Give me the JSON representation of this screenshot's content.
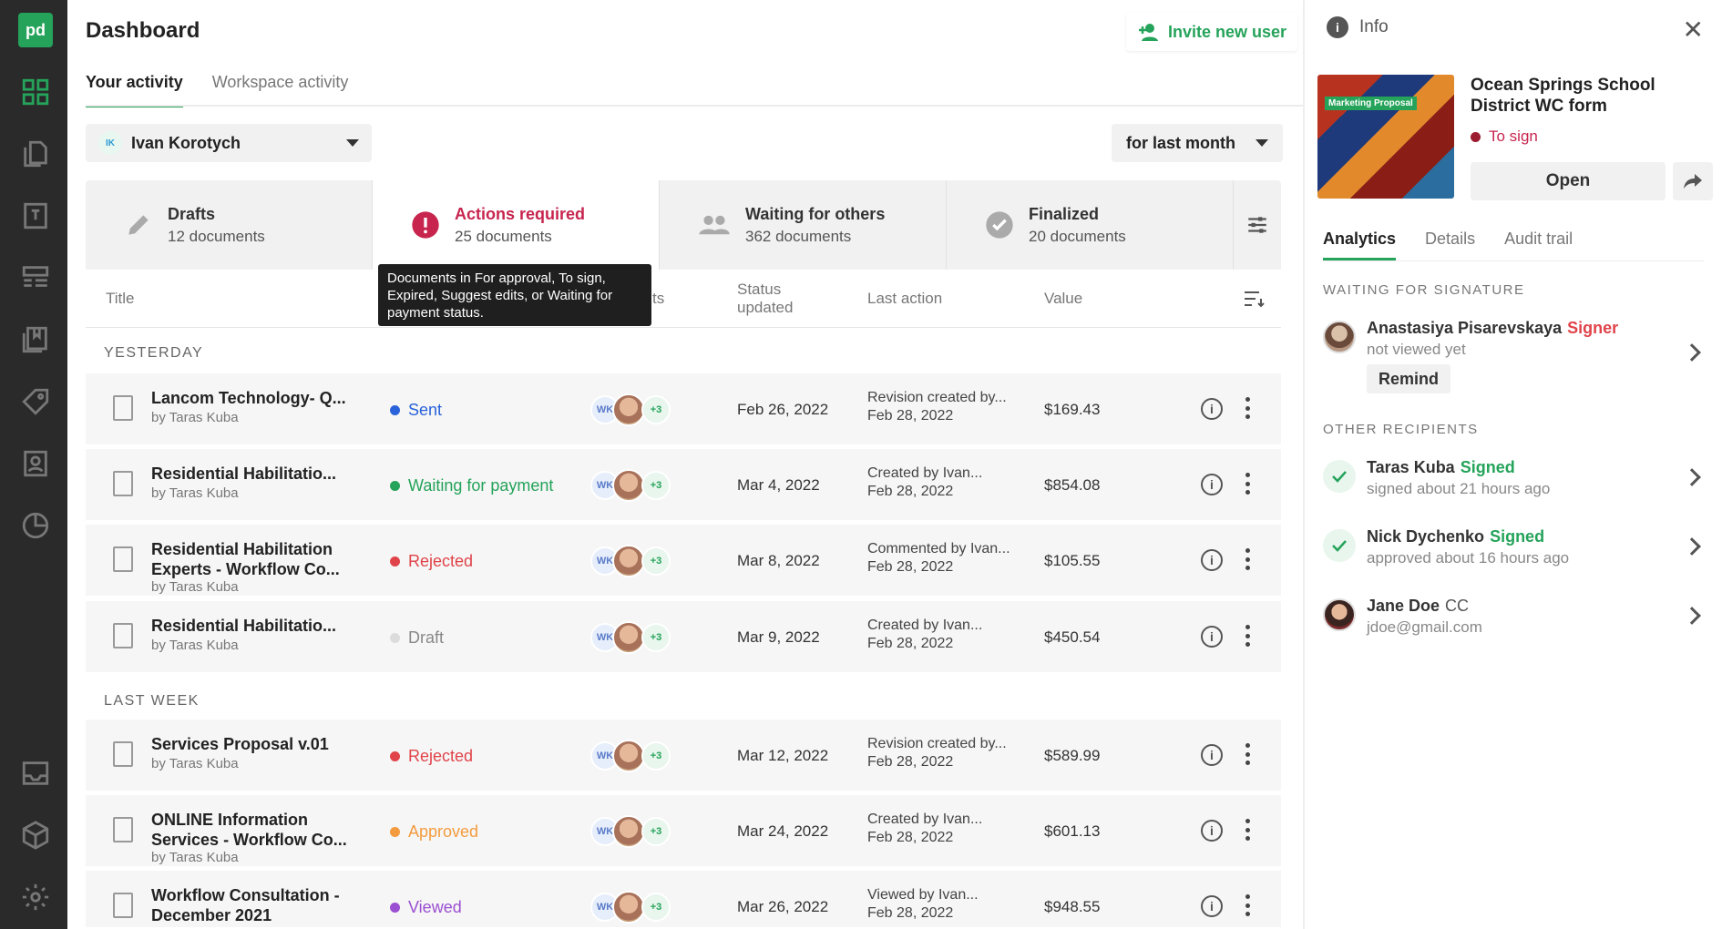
{
  "rail": {
    "logo": "pd",
    "icons": [
      "dashboard-icon",
      "documents-icon",
      "templates-icon",
      "catalog-icon",
      "content-library-icon",
      "tag-icon",
      "contacts-icon",
      "reports-icon",
      "inbox-icon",
      "integrations-icon",
      "settings-icon"
    ]
  },
  "header": {
    "title": "Dashboard",
    "invite_label": "Invite new user",
    "tabs": [
      "Your activity",
      "Workspace activity"
    ]
  },
  "filters": {
    "user_initials": "IK",
    "user_name": "Ivan Korotych",
    "period": "for last month"
  },
  "cards": [
    {
      "title": "Drafts",
      "count": "12 documents"
    },
    {
      "title": "Actions required",
      "count": "25 documents"
    },
    {
      "title": "Waiting for others",
      "count": "362 documents"
    },
    {
      "title": "Finalized",
      "count": "20 documents"
    }
  ],
  "tooltip": "Documents in For approval, To sign, Expired, Suggest edits, or Waiting for payment status.",
  "table": {
    "headers": {
      "title": "Title",
      "recipients_tail": "ts",
      "status_updated": "Status updated",
      "last_action": "Last action",
      "value": "Value"
    },
    "groups": {
      "yesterday": "YESTERDAY",
      "last_week": "LAST WEEK"
    },
    "avatar_initials": "WK",
    "avatar_more": "+3",
    "rows": [
      {
        "title": "Lancom Technology- Q...",
        "by": "by Taras Kuba",
        "status": "Sent",
        "status_color": "#2962d9",
        "updated": "Feb 26, 2022",
        "action": "Revision created by...",
        "action_date": "Feb 28, 2022",
        "value": "$169.43"
      },
      {
        "title": "Residential Habilitatio...",
        "by": "by Taras Kuba",
        "status": "Waiting for payment",
        "status_color": "#25a35a",
        "updated": "Mar 4, 2022",
        "action": "Created by Ivan...",
        "action_date": "Feb 28, 2022",
        "value": "$854.08"
      },
      {
        "title": "Residential Habilitation Experts - Workflow Co...",
        "by": "by Taras Kuba",
        "status": "Rejected",
        "status_color": "#e0444a",
        "updated": "Mar 8, 2022",
        "action": "Commented by Ivan...",
        "action_date": "Feb 28, 2022",
        "value": "$105.55"
      },
      {
        "title": "Residential Habilitatio...",
        "by": "by Taras Kuba",
        "status": "Draft",
        "status_color": "#dcdcdc",
        "updated": "Mar 9, 2022",
        "action": "Created by Ivan...",
        "action_date": "Feb 28, 2022",
        "value": "$450.54"
      },
      {
        "title": "Services Proposal v.01",
        "by": "by Taras Kuba",
        "status": "Rejected",
        "status_color": "#e0444a",
        "updated": "Mar 12, 2022",
        "action": "Revision created by...",
        "action_date": "Feb 28, 2022",
        "value": "$589.99"
      },
      {
        "title": "ONLINE Information Services - Workflow Co...",
        "by": "by Taras Kuba",
        "status": "Approved",
        "status_color": "#f39c3f",
        "updated": "Mar 24, 2022",
        "action": "Created by Ivan...",
        "action_date": "Feb 28, 2022",
        "value": "$601.13"
      },
      {
        "title": "Workflow Consultation - December 2021",
        "by": "",
        "status": "Viewed",
        "status_color": "#9b4fd1",
        "updated": "Mar 26, 2022",
        "action": "Viewed by Ivan...",
        "action_date": "Feb 28, 2022",
        "value": "$948.55"
      }
    ]
  },
  "panel": {
    "title": "Info",
    "thumb_label": "Marketing Proposal",
    "doc_title": "Ocean Springs School District WC form",
    "doc_status": "To sign",
    "open_label": "Open",
    "tabs": [
      "Analytics",
      "Details",
      "Audit trail"
    ],
    "waiting_label": "WAITING FOR SIGNATURE",
    "other_label": "OTHER RECIPIENTS",
    "remind_label": "Remind",
    "recipients": [
      {
        "name": "Anastasiya Pisarevskaya",
        "role": "Signer",
        "role_color": "#e0444a",
        "sub": "not viewed yet"
      },
      {
        "name": "Taras Kuba",
        "role": "Signed",
        "role_color": "#25a35a",
        "sub": "signed about 21 hours ago"
      },
      {
        "name": "Nick Dychenko",
        "role": "Signed",
        "role_color": "#25a35a",
        "sub": "approved about 16 hours ago"
      },
      {
        "name": "Jane Doe",
        "role": "CC",
        "role_color": "#555555",
        "sub": "jdoe@gmail.com"
      }
    ]
  }
}
